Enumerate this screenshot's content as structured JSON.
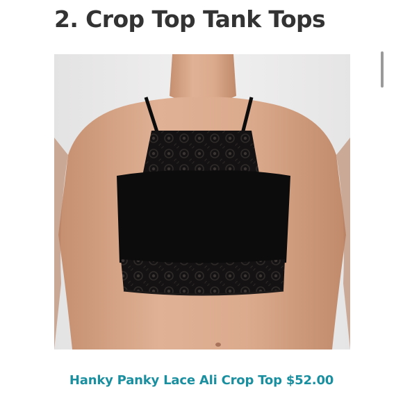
{
  "article": {
    "heading": "2. Crop Top Tank Tops",
    "product_caption": "Hanky Panky Lace Ali Crop Top $52.00"
  },
  "colors": {
    "heading": "#333333",
    "caption_link": "#1a8fa0",
    "page_background": "#ffffff",
    "photo_background": "#ebeaea",
    "garment": "#0d0c0c",
    "skin": "#d9a88a"
  },
  "image": {
    "subject": "black lace crop top worn by model"
  }
}
